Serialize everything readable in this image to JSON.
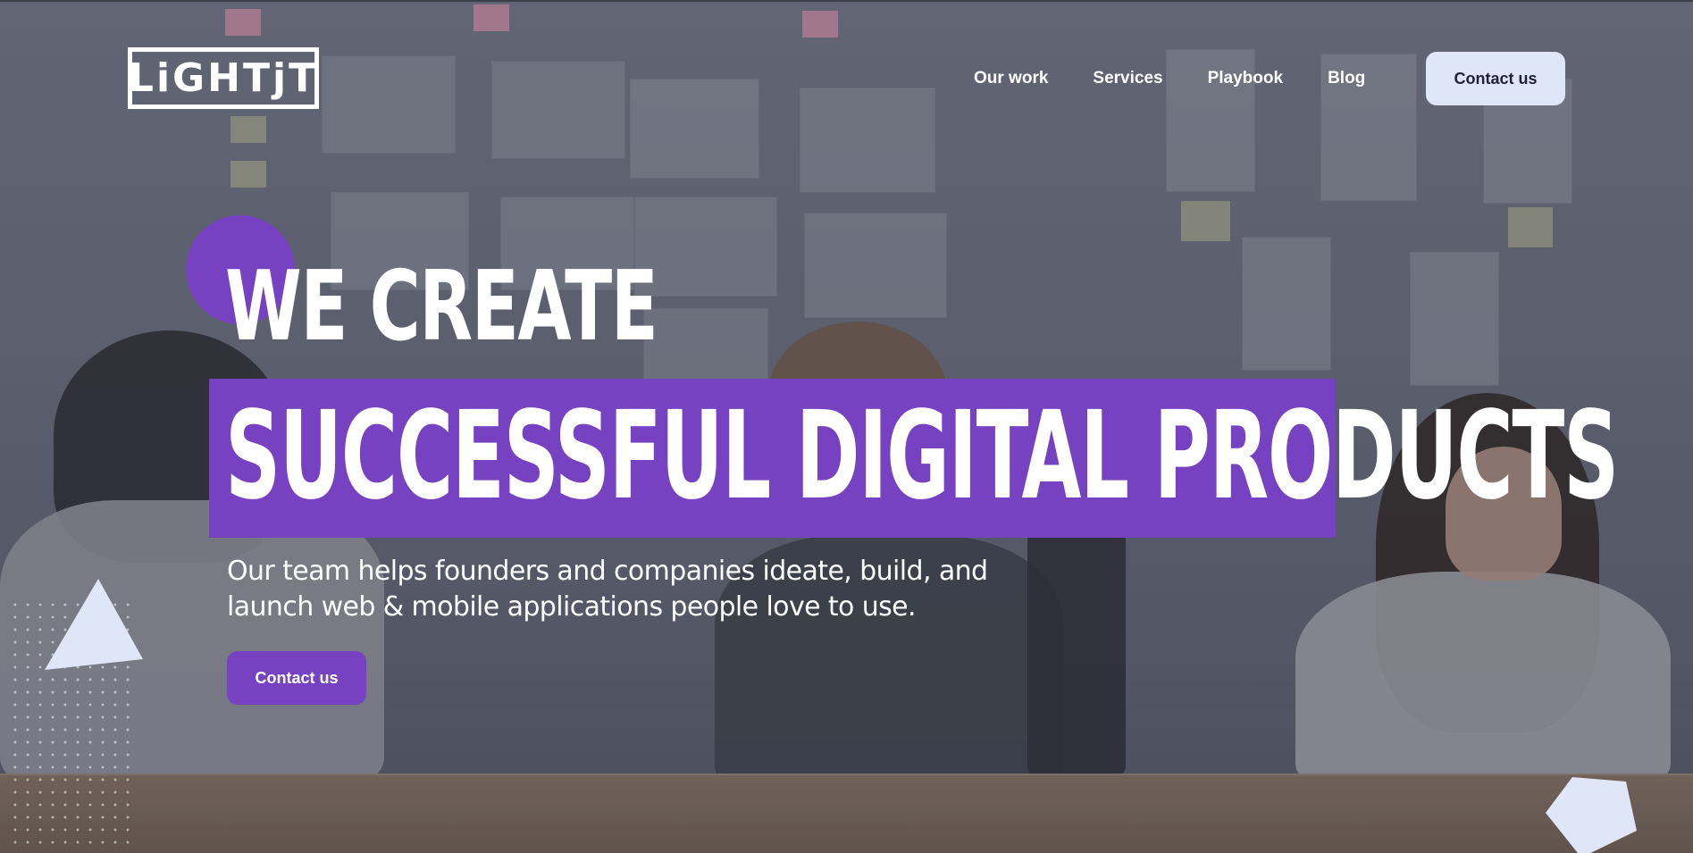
{
  "header": {
    "logo_text": "LiGHTjT",
    "nav": [
      {
        "label": "Our work"
      },
      {
        "label": "Services"
      },
      {
        "label": "Playbook"
      },
      {
        "label": "Blog"
      }
    ],
    "contact_label": "Contact us"
  },
  "hero": {
    "headline_line1": "WE CREATE",
    "headline_line2": "SUCCESSFUL DIGITAL PRODUCTS",
    "subtitle": "Our team helps founders and companies ideate, build, and launch web & mobile applications people love to use.",
    "cta_label": "Contact us"
  },
  "colors": {
    "accent_purple": "#7642c1",
    "light_button": "#dfe6f7",
    "text_white": "#ffffff"
  }
}
